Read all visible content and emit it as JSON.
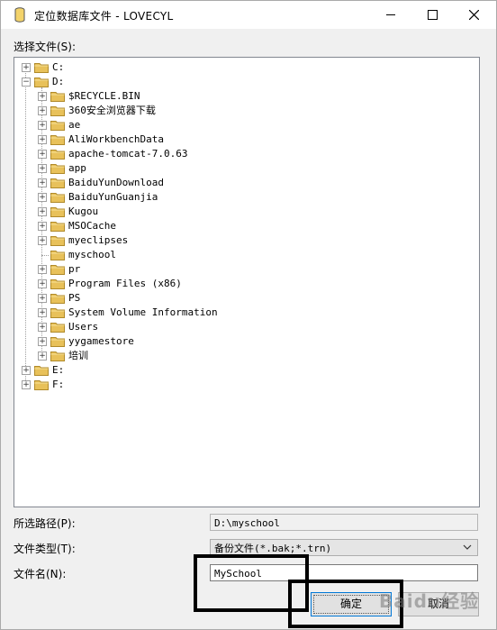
{
  "window": {
    "title": "定位数据库文件 - LOVECYL"
  },
  "labels": {
    "select_file": "选择文件(S):",
    "selected_path": "所选路径(P):",
    "file_type": "文件类型(T):",
    "file_name": "文件名(N):"
  },
  "tree": {
    "drives": [
      {
        "name": "C:",
        "expanded": false
      },
      {
        "name": "D:",
        "expanded": true
      },
      {
        "name": "E:",
        "expanded": false
      },
      {
        "name": "F:",
        "expanded": false
      }
    ],
    "d_children": [
      {
        "name": "$RECYCLE.BIN",
        "expandable": true
      },
      {
        "name": "360安全浏览器下载",
        "expandable": true
      },
      {
        "name": "ae",
        "expandable": true
      },
      {
        "name": "AliWorkbenchData",
        "expandable": true
      },
      {
        "name": "apache-tomcat-7.0.63",
        "expandable": true
      },
      {
        "name": "app",
        "expandable": true
      },
      {
        "name": "BaiduYunDownload",
        "expandable": true
      },
      {
        "name": "BaiduYunGuanjia",
        "expandable": true
      },
      {
        "name": "Kugou",
        "expandable": true
      },
      {
        "name": "MSOCache",
        "expandable": true
      },
      {
        "name": "myeclipses",
        "expandable": true
      },
      {
        "name": "myschool",
        "expandable": false
      },
      {
        "name": "pr",
        "expandable": true
      },
      {
        "name": "Program Files (x86)",
        "expandable": true
      },
      {
        "name": "PS",
        "expandable": true
      },
      {
        "name": "System Volume Information",
        "expandable": true
      },
      {
        "name": "Users",
        "expandable": true
      },
      {
        "name": "yygamestore",
        "expandable": true
      },
      {
        "name": "培训",
        "expandable": true
      }
    ]
  },
  "fields": {
    "selected_path_value": "D:\\myschool",
    "file_type_value": "备份文件(*.bak;*.trn)",
    "file_name_value": "MySchool"
  },
  "buttons": {
    "ok": "确定",
    "cancel": "取消"
  },
  "watermark": "Baidu经验",
  "colors": {
    "folder": "#e8c15a",
    "focus_border": "#0078d7"
  }
}
